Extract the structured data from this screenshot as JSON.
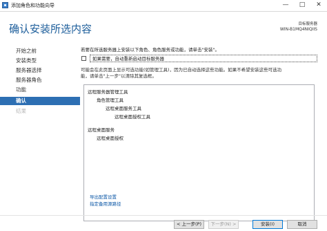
{
  "window": {
    "title": "添加角色和功能向导",
    "minimize_glyph": "—",
    "maximize_glyph": "□",
    "close_glyph": "✕"
  },
  "header": {
    "title": "确认安装所选内容",
    "destination_label": "目标服务器",
    "destination_server": "WIN-B1MQ4NIQIIS"
  },
  "nav": {
    "items": [
      {
        "label": "开始之前",
        "state": "normal"
      },
      {
        "label": "安装类型",
        "state": "normal"
      },
      {
        "label": "服务器选择",
        "state": "normal"
      },
      {
        "label": "服务器角色",
        "state": "normal"
      },
      {
        "label": "功能",
        "state": "normal"
      },
      {
        "label": "确认",
        "state": "active"
      },
      {
        "label": "结果",
        "state": "disabled"
      }
    ]
  },
  "main": {
    "intro": "若要在所选服务器上安装以下角色、角色服务或功能，请单击\"安装\"。",
    "restart_checkbox_label": "如果需要，自动重新启动目标服务器",
    "restart_checked": false,
    "note_line1": "可能会在此页面上显示可选功能(如管理工具)，因为已自动选择这些功能。如果不希望安装这些可选功",
    "note_line2": "能，请单击\"上一步\"以清除其复选框。",
    "features": [
      {
        "text": "远程服务器管理工具",
        "level": 0
      },
      {
        "text": "角色管理工具",
        "level": 1
      },
      {
        "text": "远程桌面服务工具",
        "level": 2
      },
      {
        "text": "远程桌面授权工具",
        "level": 3
      },
      {
        "text": "远程桌面服务",
        "level": 0
      },
      {
        "text": "远程桌面授权",
        "level": 1
      }
    ],
    "export_link": "导出配置设置",
    "alt_source_link": "指定备用源路径"
  },
  "footer": {
    "prev_label": "< 上一步(P)",
    "next_label": "下一步(N) >",
    "install_label": "安装(I)",
    "cancel_label": "取消"
  },
  "colors": {
    "accent": "#2d6fb3",
    "title_blue": "#1d5e9b",
    "link_blue": "#0f5aa8"
  }
}
